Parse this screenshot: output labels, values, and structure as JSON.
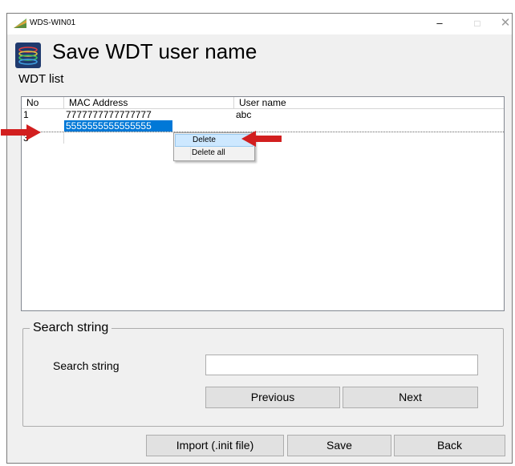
{
  "window": {
    "title": "WDS-WIN01",
    "controls": {
      "minimize": "–",
      "maximize": "□",
      "close": "✕"
    }
  },
  "header": {
    "title": "Save WDT user name"
  },
  "wdt_list": {
    "label": "WDT list",
    "columns": [
      "No",
      "MAC Address",
      "User name"
    ],
    "rows": [
      {
        "no": "1",
        "mac": "7777777777777777",
        "user": "abc"
      },
      {
        "no": "",
        "mac": "5555555555555555",
        "user": ""
      },
      {
        "no": "3",
        "mac": "",
        "user": ""
      }
    ],
    "selected_row": 1
  },
  "context_menu": {
    "items": [
      "Delete",
      "Delete all"
    ],
    "highlighted": "Delete"
  },
  "search": {
    "group_title": "Search string",
    "field_label": "Search string",
    "value": "",
    "previous_label": "Previous",
    "next_label": "Next"
  },
  "footer": {
    "import_label": "Import (.init file)",
    "save_label": "Save",
    "back_label": "Back"
  },
  "colors": {
    "selection": "#0078d7",
    "arrow": "#d21f1f",
    "menu_highlight": "#cde8ff"
  },
  "icons": [
    "app-icon",
    "logo-icon",
    "red-arrow-icon"
  ]
}
